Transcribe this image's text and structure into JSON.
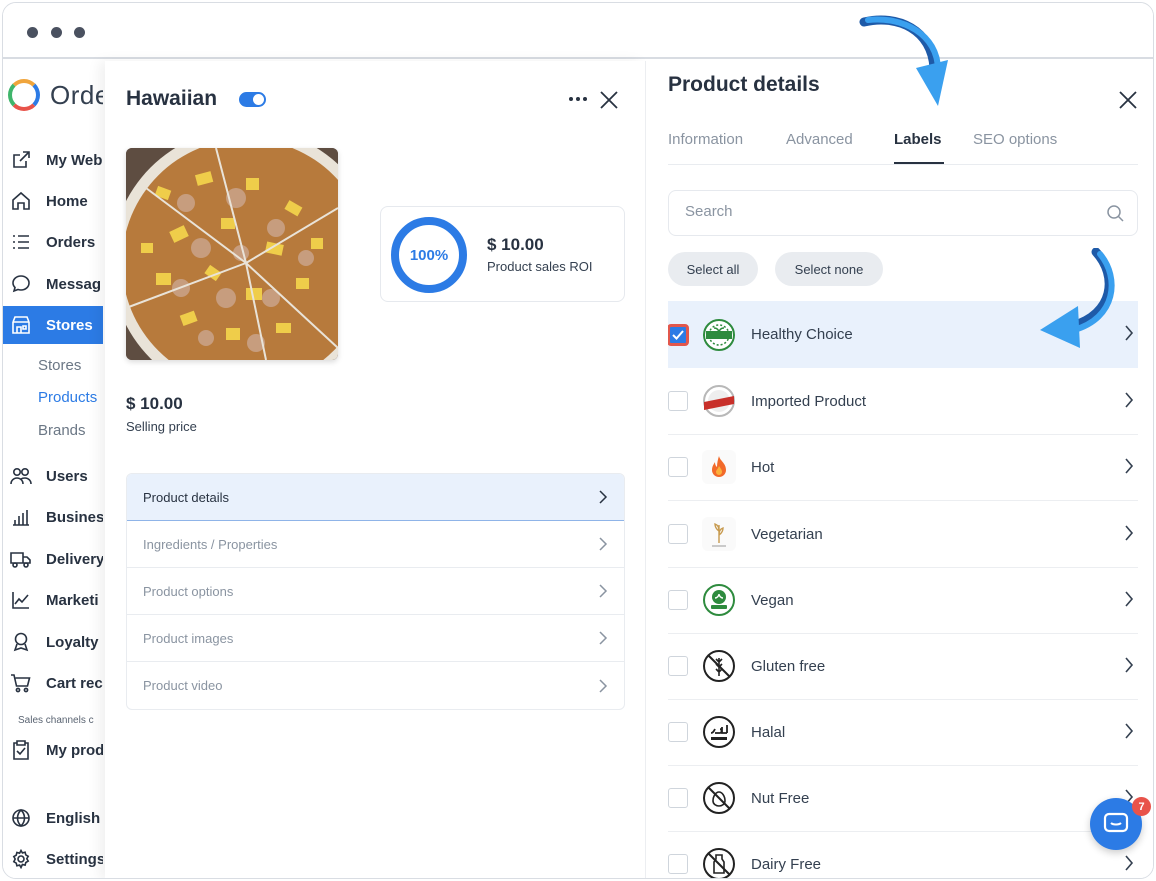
{
  "sidebar": {
    "logo_text": "Orde",
    "items": [
      {
        "label": "My Web",
        "icon": "external-link-icon"
      },
      {
        "label": "Home",
        "icon": "home-icon"
      },
      {
        "label": "Orders",
        "icon": "list-icon"
      },
      {
        "label": "Messag",
        "icon": "chat-bubble-icon"
      },
      {
        "label": "Stores",
        "icon": "store-icon"
      },
      {
        "label": "Users",
        "icon": "users-icon"
      },
      {
        "label": "Busines",
        "icon": "bar-chart-icon"
      },
      {
        "label": "Delivery",
        "icon": "truck-icon"
      },
      {
        "label": "Marketi",
        "icon": "line-chart-icon"
      },
      {
        "label": "Loyalty",
        "icon": "award-icon"
      },
      {
        "label": "Cart rec",
        "icon": "cart-icon"
      },
      {
        "label": "My prod",
        "icon": "clipboard-check-icon"
      },
      {
        "label": "English",
        "icon": "globe-icon"
      },
      {
        "label": "Settings",
        "icon": "gear-icon"
      }
    ],
    "subitems": [
      "Stores",
      "Products",
      "Brands"
    ],
    "section_caption": "Sales channels c"
  },
  "product": {
    "title": "Hawaiian",
    "roi_percent": "100%",
    "roi_value": "$ 10.00",
    "roi_label": "Product sales ROI",
    "price_value": "$ 10.00",
    "price_label": "Selling price",
    "menu": [
      "Product details",
      "Ingredients / Properties",
      "Product options",
      "Product images",
      "Product video"
    ]
  },
  "details": {
    "title": "Product details",
    "tabs": [
      "Information",
      "Advanced",
      "Labels",
      "SEO options"
    ],
    "active_tab": "Labels",
    "search_placeholder": "Search",
    "select_all": "Select all",
    "select_none": "Select none",
    "labels": [
      {
        "name": "Healthy Choice",
        "checked": true,
        "icon": "healthy-choice-badge-icon"
      },
      {
        "name": "Imported Product",
        "checked": false,
        "icon": "import-badge-icon"
      },
      {
        "name": "Hot",
        "checked": false,
        "icon": "flame-icon"
      },
      {
        "name": "Vegetarian",
        "checked": false,
        "icon": "wheat-leaf-icon"
      },
      {
        "name": "Vegan",
        "checked": false,
        "icon": "vegan-leaf-icon"
      },
      {
        "name": "Gluten free",
        "checked": false,
        "icon": "gluten-free-icon"
      },
      {
        "name": "Halal",
        "checked": false,
        "icon": "halal-icon"
      },
      {
        "name": "Nut Free",
        "checked": false,
        "icon": "nut-free-icon"
      },
      {
        "name": "Dairy Free",
        "checked": false,
        "icon": "dairy-free-icon"
      }
    ]
  },
  "chat": {
    "unread": "7"
  },
  "colors": {
    "accent": "#2c7be5",
    "text": "#283241",
    "muted": "#8a94a1",
    "highlight": "#e9f1fc",
    "badge": "#e8534a"
  }
}
